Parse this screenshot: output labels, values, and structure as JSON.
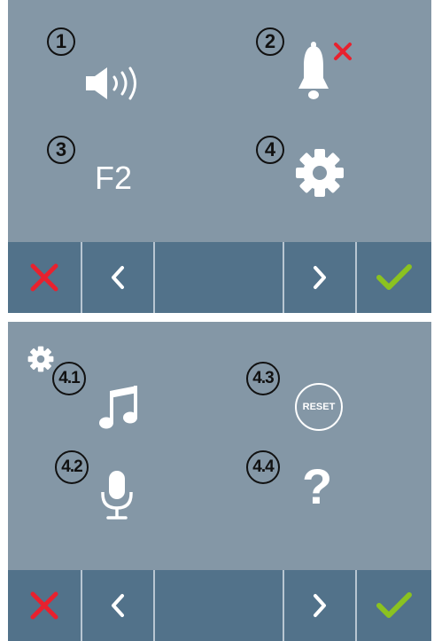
{
  "screen_main": {
    "items": [
      {
        "number": "1",
        "icon": "speaker-icon"
      },
      {
        "number": "2",
        "icon": "bell-muted-icon"
      },
      {
        "number": "3",
        "icon": "f2-function",
        "label": "F2"
      },
      {
        "number": "4",
        "icon": "gear-icon"
      }
    ]
  },
  "screen_settings": {
    "header_icon": "gear-icon",
    "items": [
      {
        "number": "4.1",
        "icon": "music-note-icon"
      },
      {
        "number": "4.3",
        "icon": "reset-icon",
        "label": "RESET"
      },
      {
        "number": "4.2",
        "icon": "microphone-icon"
      },
      {
        "number": "4.4",
        "icon": "question-icon",
        "label": "?"
      }
    ]
  },
  "toolbar": {
    "buttons": [
      "close-icon",
      "chevron-left-icon",
      "empty",
      "chevron-right-icon",
      "checkmark-icon"
    ]
  },
  "colors": {
    "screen_bg": "#8497a6",
    "toolbar_bg": "#52728a",
    "cancel": "#e8212e",
    "confirm": "#8bc220",
    "icon": "#ffffff"
  }
}
